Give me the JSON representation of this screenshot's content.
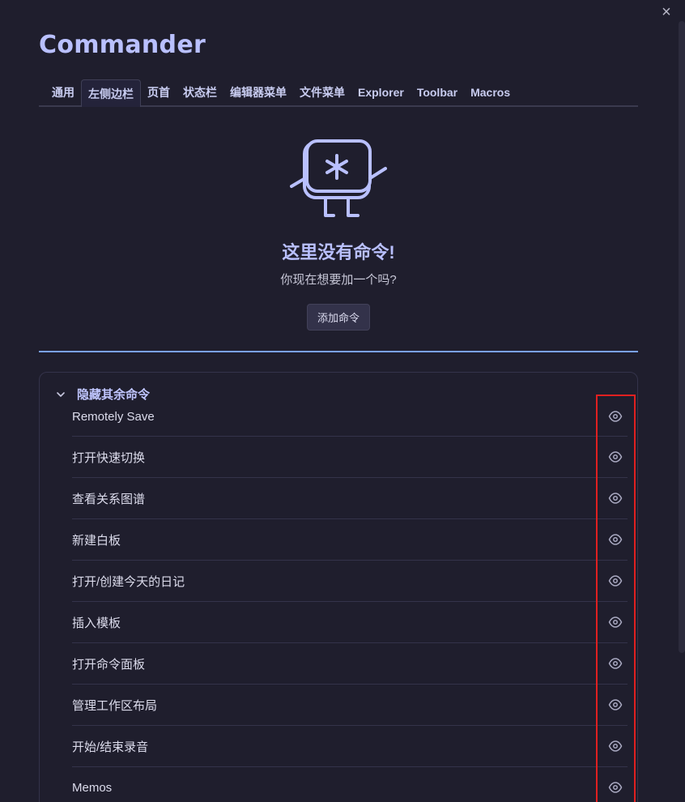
{
  "window": {
    "title": "Commander",
    "close_symbol": "×"
  },
  "tabs": [
    {
      "label": "通用",
      "active": false
    },
    {
      "label": "左侧边栏",
      "active": true
    },
    {
      "label": "页首",
      "active": false
    },
    {
      "label": "状态栏",
      "active": false
    },
    {
      "label": "编辑器菜单",
      "active": false
    },
    {
      "label": "文件菜单",
      "active": false
    },
    {
      "label": "Explorer",
      "active": false
    },
    {
      "label": "Toolbar",
      "active": false
    },
    {
      "label": "Macros",
      "active": false
    }
  ],
  "empty_state": {
    "icon": "asterisk-robot-icon",
    "title": "这里没有命令!",
    "subtitle": "你现在想要加一个吗?",
    "add_button_label": "添加命令"
  },
  "hidden_section": {
    "title": "隐藏其余命令",
    "expanded": true,
    "commands": [
      {
        "label": "Remotely Save",
        "icon": "eye-icon"
      },
      {
        "label": "打开快速切换",
        "icon": "eye-icon"
      },
      {
        "label": "查看关系图谱",
        "icon": "eye-icon"
      },
      {
        "label": "新建白板",
        "icon": "eye-icon"
      },
      {
        "label": "打开/创建今天的日记",
        "icon": "eye-icon"
      },
      {
        "label": "插入模板",
        "icon": "eye-icon"
      },
      {
        "label": "打开命令面板",
        "icon": "eye-icon"
      },
      {
        "label": "管理工作区布局",
        "icon": "eye-icon"
      },
      {
        "label": "开始/结束录音",
        "icon": "eye-icon"
      },
      {
        "label": "Memos",
        "icon": "eye-icon"
      }
    ]
  },
  "colors": {
    "background": "#1f1e2d",
    "accent": "#b9c0ff",
    "divider": "#7aa2f7",
    "highlight": "#e02020"
  }
}
